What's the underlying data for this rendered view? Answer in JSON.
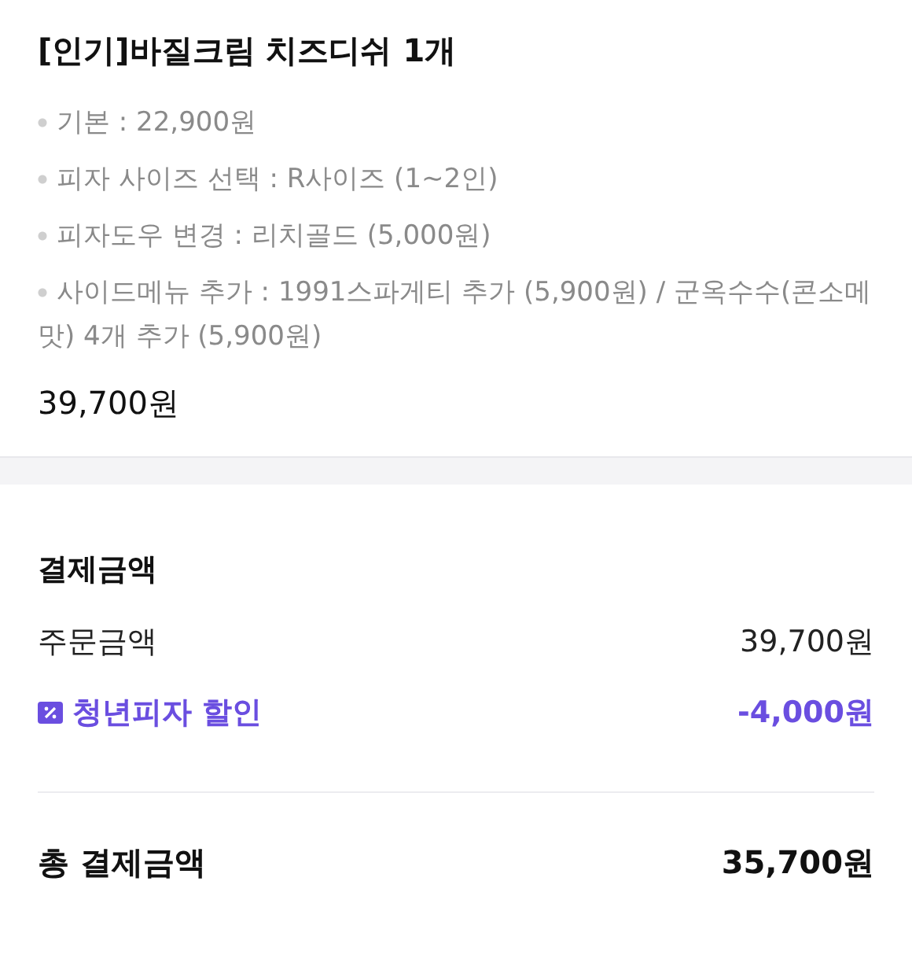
{
  "order_item": {
    "title": "[인기]바질크림 치즈디쉬 1개",
    "options": [
      "기본 : 22,900원",
      "피자 사이즈 선택 : R사이즈 (1~2인)",
      "피자도우 변경 : 리치골드 (5,000원)",
      "사이드메뉴 추가 : 1991스파게티 추가 (5,900원) / 군옥수수(콘소메맛) 4개 추가 (5,900원)"
    ],
    "price": "39,700원"
  },
  "payment": {
    "title": "결제금액",
    "rows": [
      {
        "kind": "amount",
        "label": "주문금액",
        "value": "39,700원"
      },
      {
        "kind": "discount",
        "label": "청년피자 할인",
        "value": "-4,000원"
      }
    ],
    "total": {
      "label": "총 결제금액",
      "value": "35,700원"
    }
  }
}
